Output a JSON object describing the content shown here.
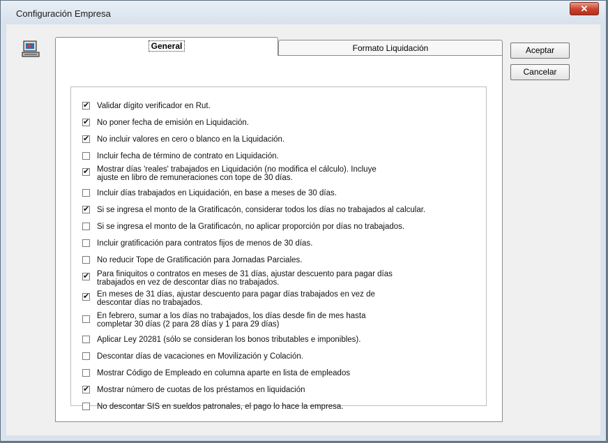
{
  "window": {
    "title": "Configuración Empresa",
    "close_symbol": "✕"
  },
  "tabs": [
    {
      "label": "General",
      "active": true
    },
    {
      "label": "Formato Liquidación",
      "active": false
    }
  ],
  "buttons": {
    "accept": "Aceptar",
    "cancel": "Cancelar"
  },
  "options": [
    {
      "line1": "Validar dígito verificador en Rut.",
      "line2": "",
      "checked": true
    },
    {
      "line1": "No poner fecha de emisión en Liquidación.",
      "line2": "",
      "checked": true
    },
    {
      "line1": "No incluir valores en cero o blanco en la Liquidación.",
      "line2": "",
      "checked": true
    },
    {
      "line1": "Incluir fecha de término de contrato en Liquidación.",
      "line2": "",
      "checked": false
    },
    {
      "line1": "Mostrar días 'reales' trabajados en Liquidación (no modifica el cálculo). Incluye",
      "line2": "ajuste en libro de remuneraciones con tope de 30 días.",
      "checked": true
    },
    {
      "line1": "Incluir días trabajados en Liquidación, en base a meses de 30 días.",
      "line2": "",
      "checked": false
    },
    {
      "line1": "Si se ingresa el monto de la Gratificacón, considerar todos los días no trabajados al calcular.",
      "line2": "",
      "checked": true
    },
    {
      "line1": "Si se ingresa el monto de la Gratificacón, no aplicar proporción por días no trabajados.",
      "line2": "",
      "checked": false
    },
    {
      "line1": "Incluir gratificación para contratos fijos de menos de 30 días.",
      "line2": "",
      "checked": false
    },
    {
      "line1": "No reducir Tope de Gratificación para Jornadas Parciales.",
      "line2": "",
      "checked": false
    },
    {
      "line1": "Para finiquitos o contratos en meses de 31 días, ajustar descuento para pagar días",
      "line2": "trabajados en vez de descontar días no trabajados.",
      "checked": true
    },
    {
      "line1": "En meses de 31 días, ajustar descuento para pagar días trabajados en vez de",
      "line2": "descontar días no trabajados.",
      "checked": true
    },
    {
      "line1": "En febrero, sumar a los días no trabajados, los días desde fin de mes hasta",
      "line2": "completar 30 días (2 para 28 días y 1 para 29 días)",
      "checked": false
    },
    {
      "line1": "Aplicar Ley 20281 (sólo se consideran los bonos tributables e imponibles).",
      "line2": "",
      "checked": false
    },
    {
      "line1": "Descontar días de vacaciones en Movilización y Colación.",
      "line2": "",
      "checked": false
    },
    {
      "line1": "Mostrar Código de Empleado en columna aparte en lista de empleados",
      "line2": "",
      "checked": false
    },
    {
      "line1": "Mostrar  número de cuotas de los préstamos en liquidación",
      "line2": "",
      "checked": true
    },
    {
      "line1": "No descontar SIS en sueldos patronales, el pago lo hace la empresa.",
      "line2": "",
      "checked": false
    }
  ]
}
